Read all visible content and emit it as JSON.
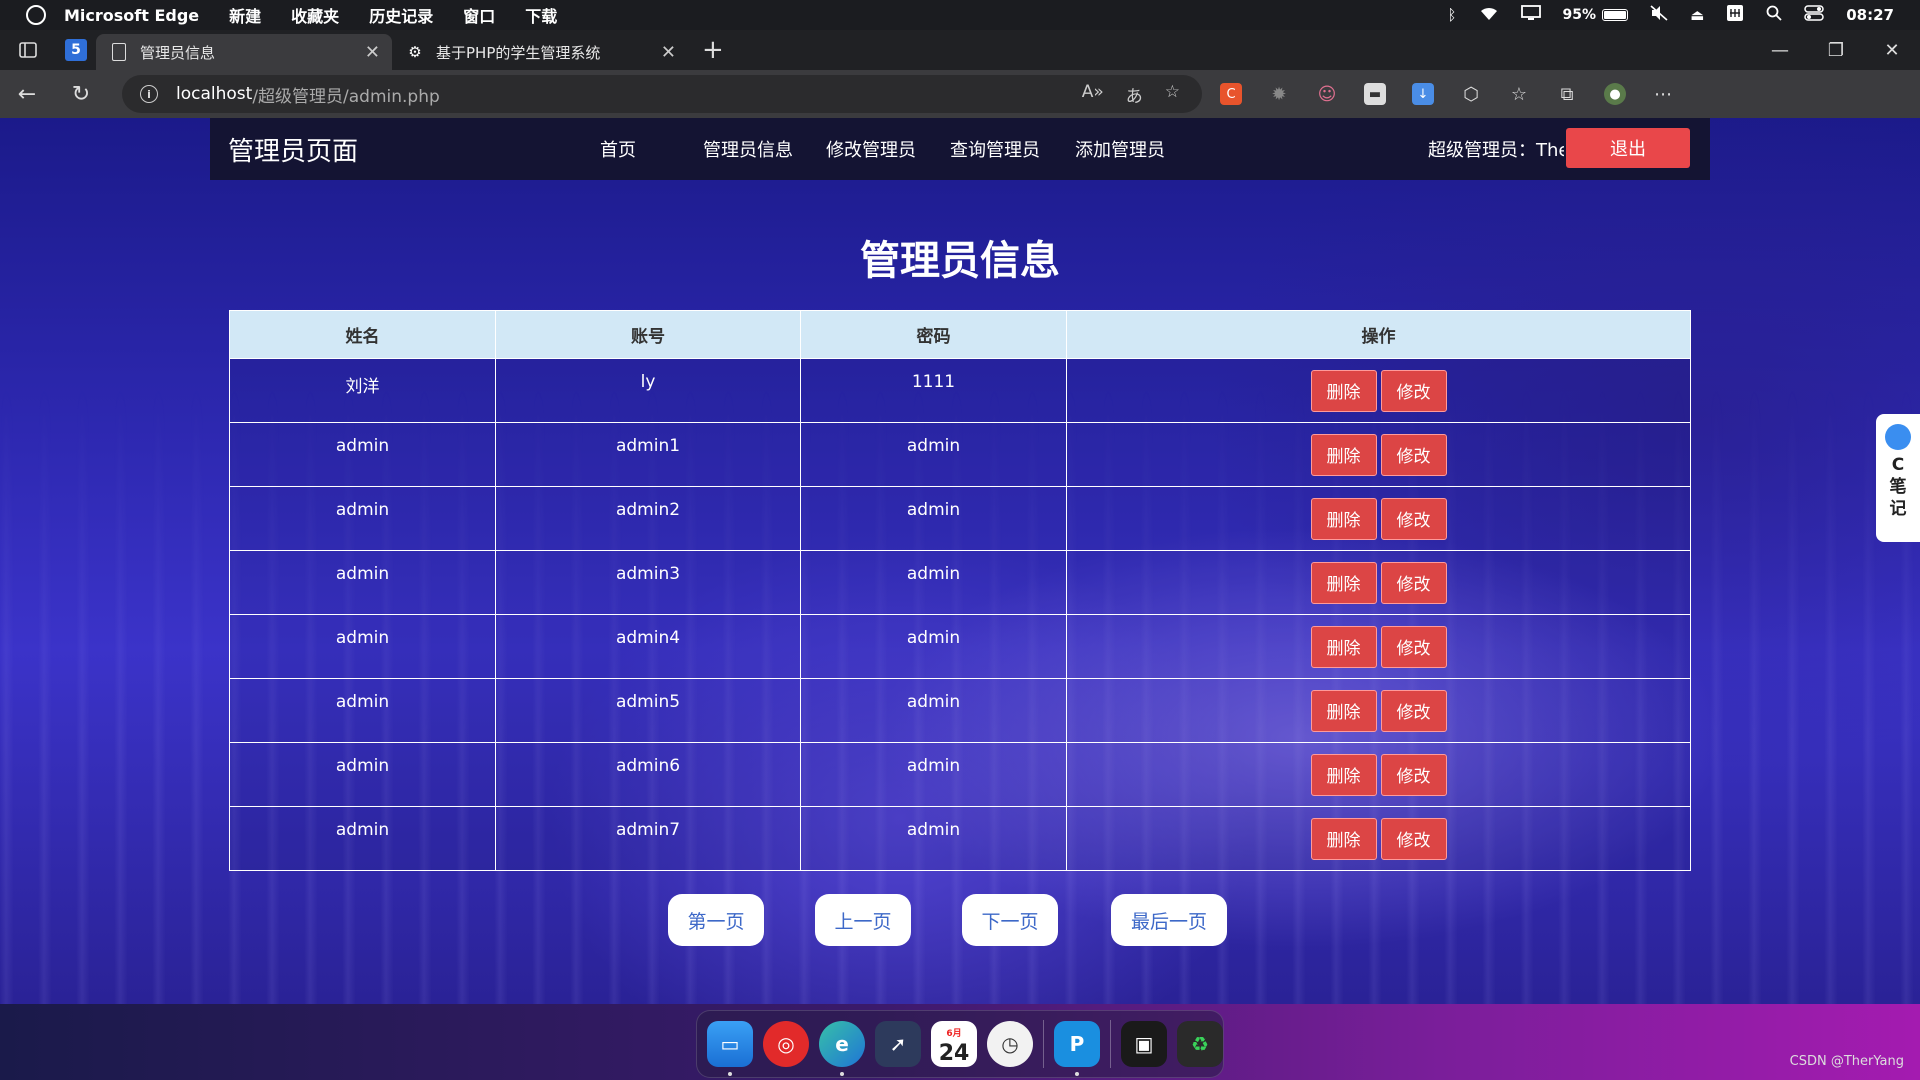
{
  "menubar": {
    "app_name": "Microsoft Edge",
    "items": [
      "新建",
      "收藏夹",
      "历史记录",
      "窗口",
      "下载"
    ],
    "battery": "95%",
    "time": "08:27"
  },
  "browser": {
    "tabs": [
      {
        "title": "管理员信息",
        "active": true
      },
      {
        "title": "基于PHP的学生管理系统",
        "active": false
      }
    ],
    "url_host": "localhost",
    "url_path": "/超级管理员/admin.php"
  },
  "nav": {
    "brand": "管理员页面",
    "links": [
      "首页",
      "管理员信息",
      "修改管理员",
      "查询管理员",
      "添加管理员"
    ],
    "user_label": "超级管理员：TherYang",
    "logout": "退出"
  },
  "heading": "管理员信息",
  "table": {
    "headers": [
      "姓名",
      "账号",
      "密码",
      "操作"
    ],
    "rows": [
      {
        "name": "刘洋",
        "account": "ly",
        "password": "1111"
      },
      {
        "name": "admin",
        "account": "admin1",
        "password": "admin"
      },
      {
        "name": "admin",
        "account": "admin2",
        "password": "admin"
      },
      {
        "name": "admin",
        "account": "admin3",
        "password": "admin"
      },
      {
        "name": "admin",
        "account": "admin4",
        "password": "admin"
      },
      {
        "name": "admin",
        "account": "admin5",
        "password": "admin"
      },
      {
        "name": "admin",
        "account": "admin6",
        "password": "admin"
      },
      {
        "name": "admin",
        "account": "admin7",
        "password": "admin"
      }
    ],
    "delete_label": "删除",
    "edit_label": "修改"
  },
  "pager": {
    "first": "第一页",
    "prev": "上一页",
    "next": "下一页",
    "last": "最后一页"
  },
  "side_note": [
    "C",
    "笔",
    "记"
  ],
  "dock": {
    "calendar_month": "6月",
    "calendar_day": "24"
  },
  "credit": "CSDN @TherYang",
  "colors": {
    "nav_bg": "#141433",
    "logout_bg": "#e9474a",
    "header_bg": "#d2e8f6",
    "op_button_bg": "#dc4545",
    "pager_text": "#3d68c8"
  }
}
